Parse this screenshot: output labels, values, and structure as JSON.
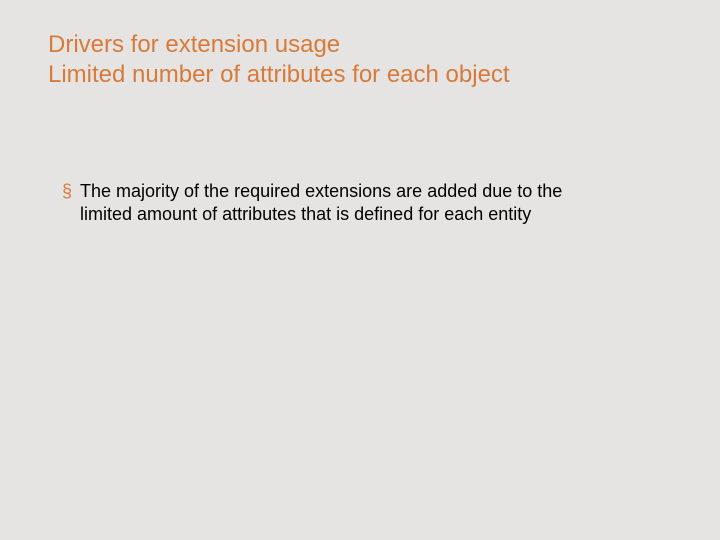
{
  "title": {
    "line1": "Drivers for extension usage",
    "line2": "Limited number of attributes for each object"
  },
  "bullets": [
    {
      "marker": "§",
      "text": "The majority of the required extensions are added due to the limited amount of attributes that is defined for each entity"
    }
  ],
  "colors": {
    "accent": "#d77a3a",
    "background": "#e5e4e2",
    "text": "#000000"
  }
}
